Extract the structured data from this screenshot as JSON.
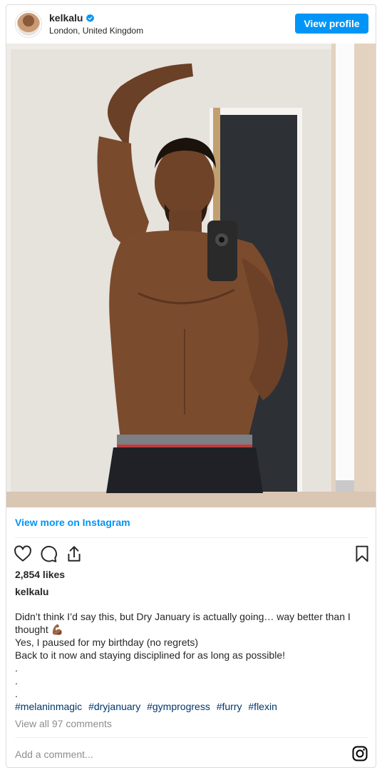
{
  "post": {
    "username": "kelkalu",
    "location": "London, United Kingdom",
    "view_profile_label": "View profile",
    "view_more_label": "View more on Instagram",
    "likes": "2,854 likes",
    "author": "kelkalu",
    "caption_lines": [
      "Didn’t think I’d say this, but Dry January is actually going… way better than I thought 💪🏾",
      "Yes, I paused for my birthday (no regrets)",
      "Back to it now and staying disciplined for as long as possible!",
      ".",
      ".",
      "."
    ],
    "hashtags": [
      "#melaninmagic",
      "#dryjanuary",
      "#gymprogress",
      "#furry",
      "#flexin"
    ],
    "comments_label": "View all 97 comments",
    "add_comment_placeholder": "Add a comment..."
  },
  "icons": {
    "verified": "verified-badge-icon",
    "like": "heart-icon",
    "comment": "comment-icon",
    "share": "share-icon",
    "save": "bookmark-icon",
    "instagram": "instagram-icon"
  },
  "colors": {
    "accent": "#0095f6",
    "hashtag": "#00376b",
    "muted": "#8e8e8e"
  }
}
